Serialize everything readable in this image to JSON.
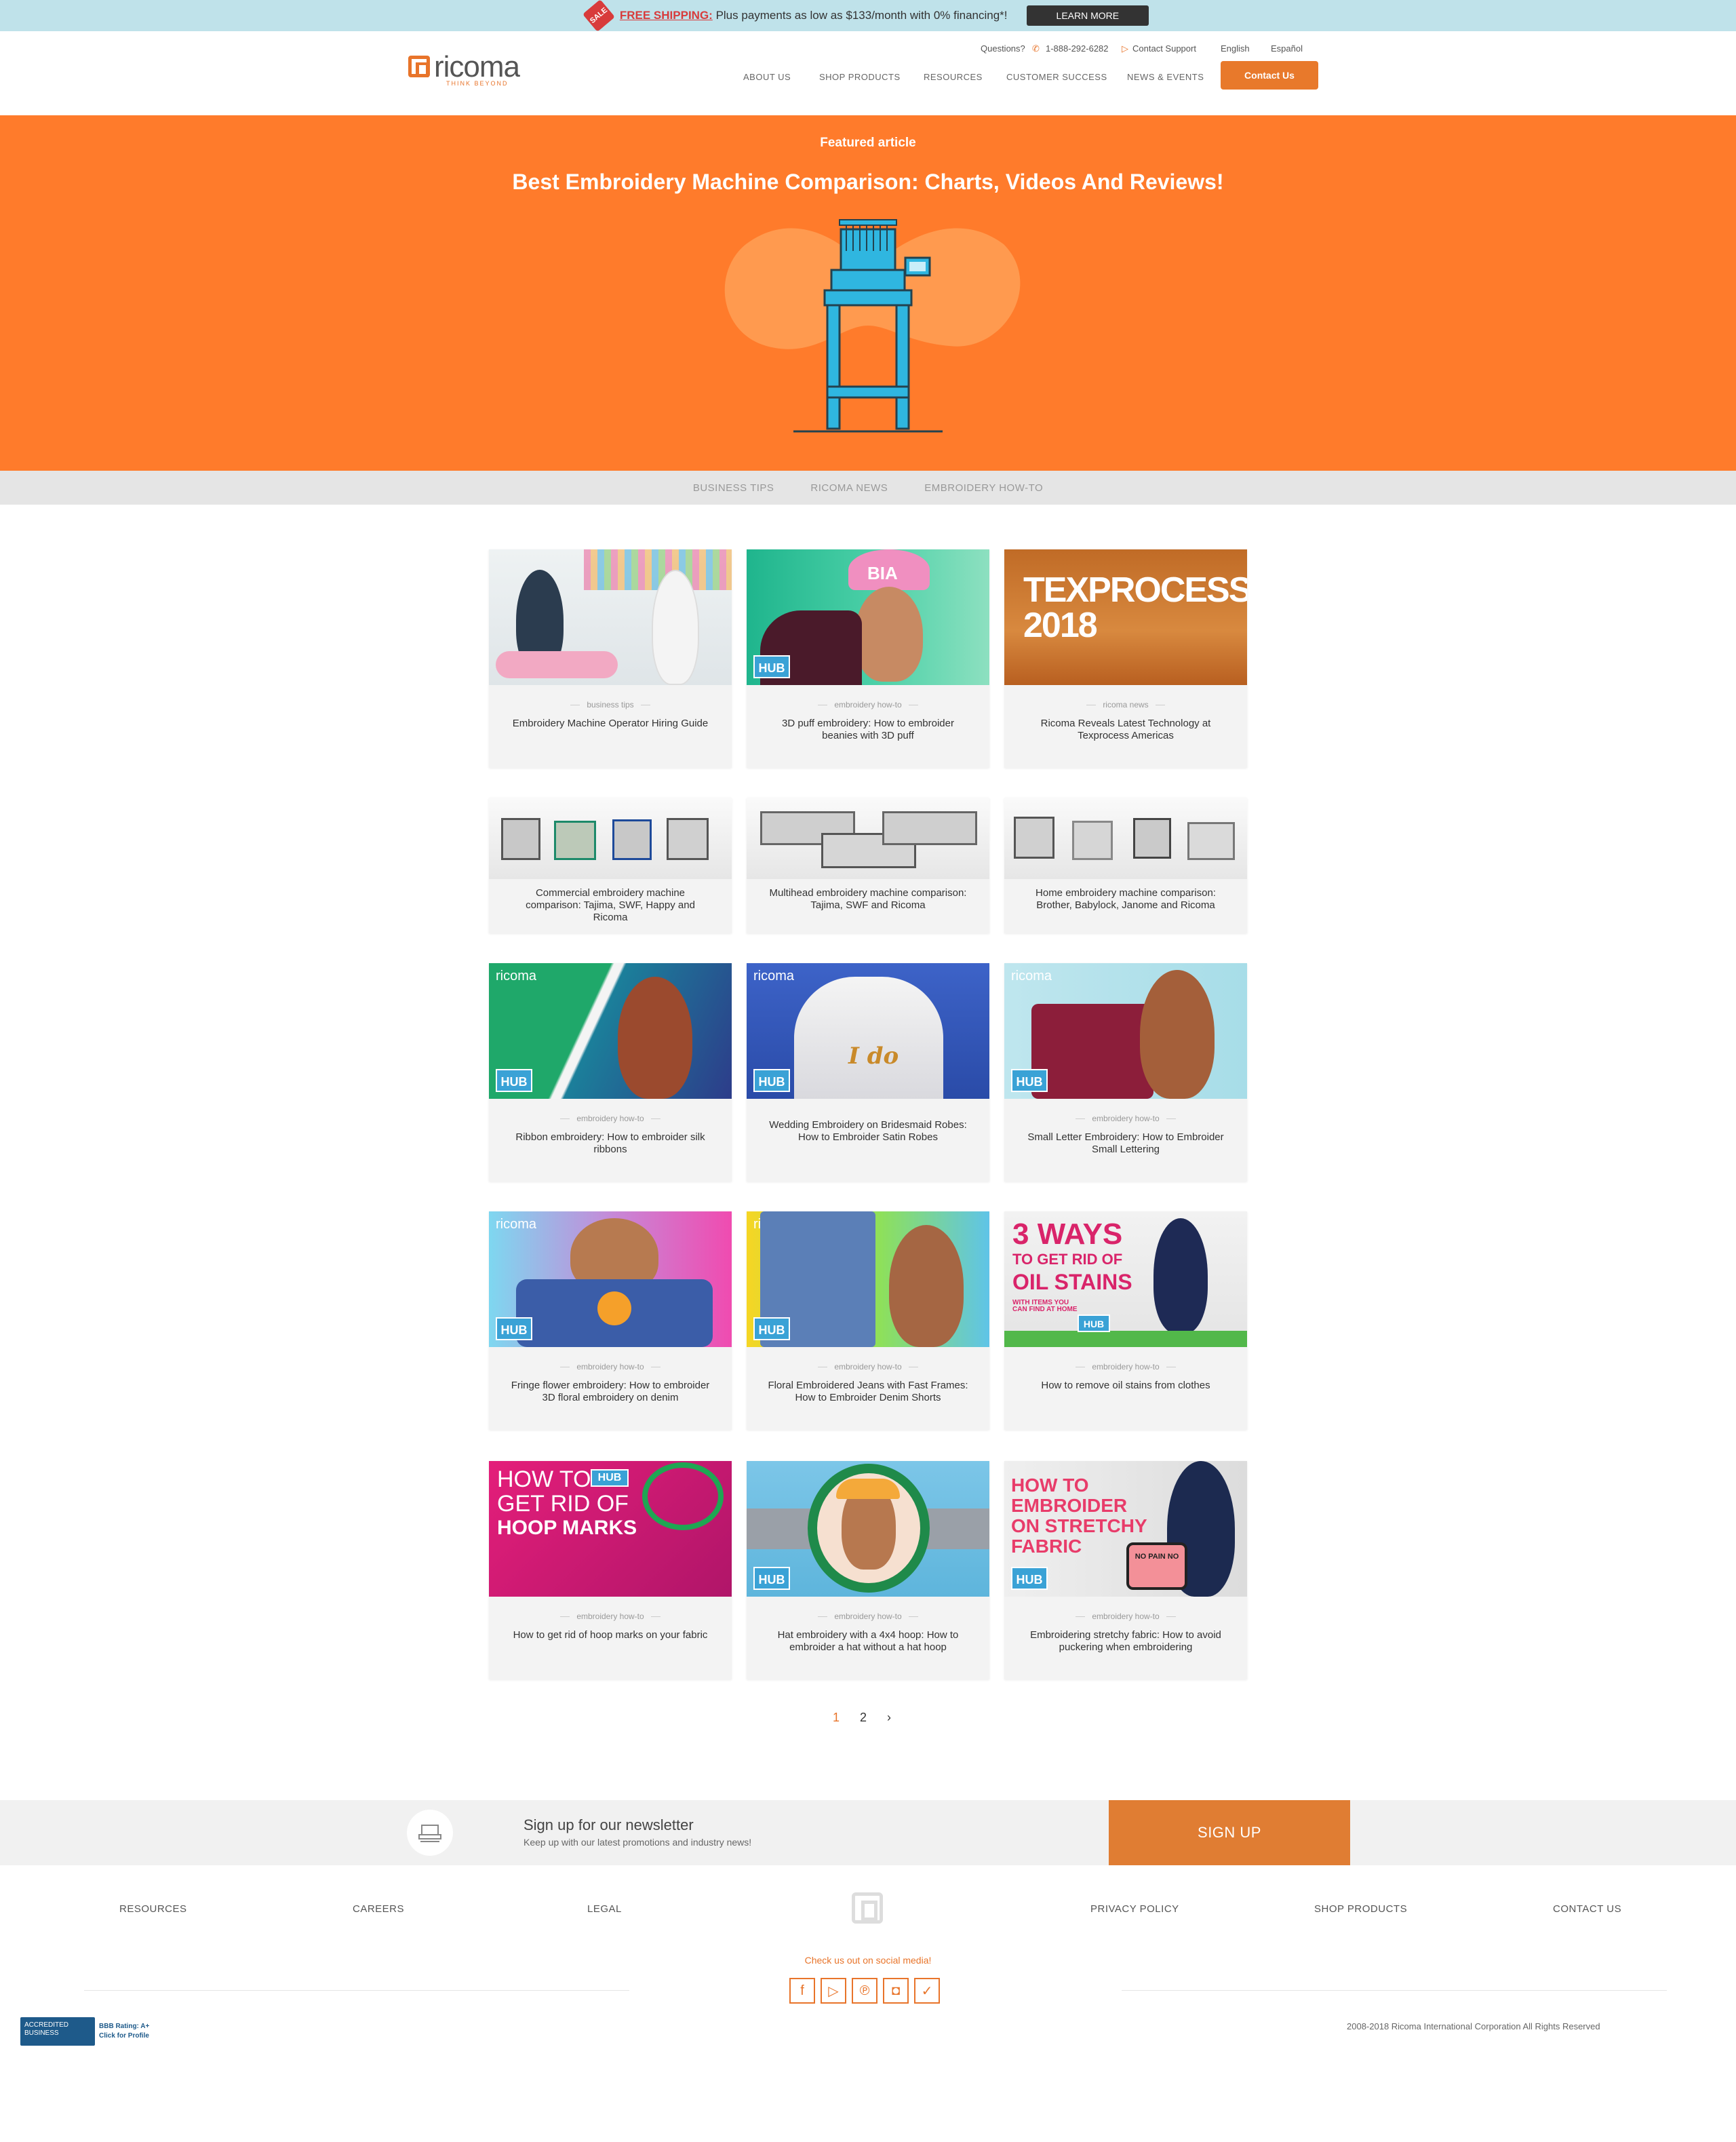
{
  "promo": {
    "sale_icon": "SALE",
    "free_shipping": "FREE SHIPPING:",
    "text": " Plus payments as low as $133/month with 0% financing*!",
    "button": "LEARN MORE"
  },
  "header": {
    "logo_word": "ricoma",
    "logo_tagline": "THINK BEYOND",
    "questions": "Questions?",
    "phone": "1-888-292-6282",
    "support": "Contact Support",
    "lang_en": "English",
    "lang_es": "Español",
    "nav": [
      "ABOUT US",
      "SHOP PRODUCTS",
      "RESOURCES",
      "CUSTOMER SUCCESS",
      "NEWS & EVENTS"
    ],
    "contact_button": "Contact Us"
  },
  "hero": {
    "kicker": "Featured article",
    "title": "Best Embroidery Machine Comparison: Charts, Videos And Reviews!"
  },
  "categories": [
    "BUSINESS TIPS",
    "RICOMA NEWS",
    "EMBROIDERY HOW-TO"
  ],
  "articles": [
    {
      "category": "business tips",
      "title": "Embroidery Machine Operator Hiring Guide"
    },
    {
      "category": "embroidery how-to",
      "title": "3D puff embroidery: How to embroider beanies with 3D puff"
    },
    {
      "category": "ricoma news",
      "title": "Ricoma Reveals Latest Technology at Texprocess Americas"
    },
    {
      "category": "",
      "title": "Commercial embroidery machine comparison: Tajima, SWF, Happy and Ricoma"
    },
    {
      "category": "",
      "title": "Multihead embroidery machine comparison: Tajima, SWF and Ricoma"
    },
    {
      "category": "",
      "title": "Home embroidery machine comparison: Brother, Babylock, Janome and Ricoma"
    },
    {
      "category": "embroidery how-to",
      "title": "Ribbon embroidery: How to embroider silk ribbons"
    },
    {
      "category": "",
      "title": "Wedding Embroidery on Bridesmaid Robes: How to Embroider Satin Robes"
    },
    {
      "category": "embroidery how-to",
      "title": "Small Letter Embroidery: How to Embroider Small Lettering"
    },
    {
      "category": "embroidery how-to",
      "title": "Fringe flower embroidery: How to embroider 3D floral embroidery on denim"
    },
    {
      "category": "embroidery how-to",
      "title": "Floral Embroidered Jeans with Fast Frames: How to Embroider Denim Shorts"
    },
    {
      "category": "embroidery how-to",
      "title": "How to remove oil stains from clothes"
    },
    {
      "category": "embroidery how-to",
      "title": "How to get rid of hoop marks on your fabric"
    },
    {
      "category": "embroidery how-to",
      "title": "Hat embroidery with a 4x4 hoop: How to embroider a hat without a hat hoop"
    },
    {
      "category": "embroidery how-to",
      "title": "Embroidering stretchy fabric: How to avoid puckering when embroidering"
    }
  ],
  "thumbs": {
    "texprocess": "TEXPROCESS 2018",
    "hub": "HUB",
    "brand": "ricoma",
    "beanie": "BIA",
    "ido": "I do",
    "oil_line1": "3 WAYS",
    "oil_line2": "TO GET RID OF",
    "oil_line3": "OIL STAINS",
    "oil_line4": "WITH ITEMS YOU CAN FIND AT HOME",
    "hoop_line1": "HOW TO",
    "hoop_line2": "GET RID OF",
    "hoop_line3": "HOOP MARKS",
    "stretch_line1": "HOW TO",
    "stretch_line2": "EMBROIDER",
    "stretch_line3": "ON STRETCHY",
    "stretch_line4": "FABRIC",
    "sign": "NO PAIN NO"
  },
  "pagination": {
    "page1": "1",
    "page2": "2",
    "next": "›"
  },
  "newsletter": {
    "title": "Sign up for our newsletter",
    "subtitle": "Keep up with our latest promotions and industry news!",
    "button": "SIGN UP"
  },
  "footer": {
    "links": [
      "RESOURCES",
      "CAREERS",
      "LEGAL",
      "PRIVACY POLICY",
      "SHOP PRODUCTS",
      "CONTACT US"
    ],
    "social_label": "Check us out on social media!",
    "social_icons": [
      "facebook-icon",
      "youtube-icon",
      "pinterest-icon",
      "instagram-icon",
      "twitter-icon"
    ],
    "bbb_box": "ACCREDITED BUSINESS",
    "bbb_rating": "BBB Rating: A+",
    "bbb_click": "Click for Profile",
    "copyright": "2008-2018 Ricoma International Corporation   All Rights Reserved"
  },
  "colors": {
    "accent": "#e8792b",
    "hero": "#ff7b2b",
    "promo_bg": "#bfe2ea",
    "hub_blue": "#3aa2d6"
  }
}
